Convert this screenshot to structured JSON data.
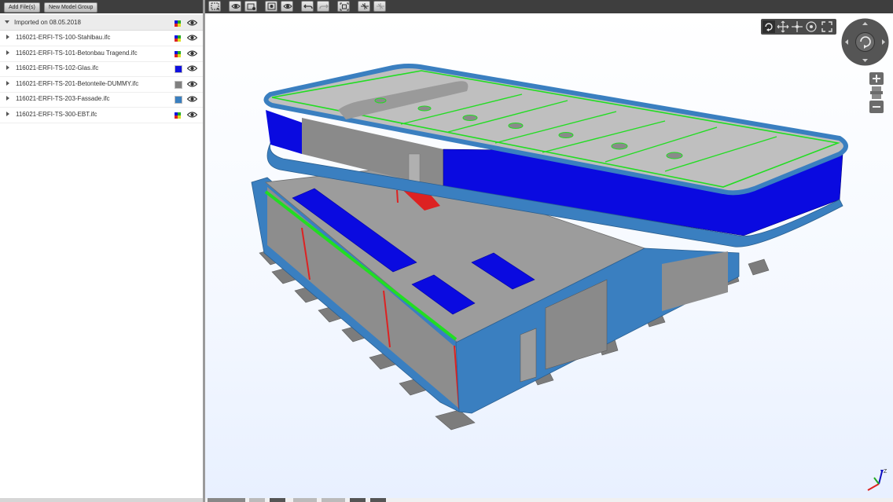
{
  "toolbar": {
    "add_files": "Add File(s)",
    "new_model_group": "New Model Group"
  },
  "model_group": {
    "label": "Imported on 08.05.2018"
  },
  "files": [
    {
      "label": "116021-ERFI-TS-100-Stahlbau.ifc",
      "swatch": "multi"
    },
    {
      "label": "116021-ERFI-TS-101-Betonbau Tragend.ifc",
      "swatch": "multi"
    },
    {
      "label": "116021-ERFI-TS-102-Glas.ifc",
      "swatch": "#1010e0"
    },
    {
      "label": "116021-ERFI-TS-201-Betonteile-DUMMY.ifc",
      "swatch": "#808080"
    },
    {
      "label": "116021-ERFI-TS-203-Fassade.ifc",
      "swatch": "#3a7fc0"
    },
    {
      "label": "116021-ERFI-TS-300-EBT.ifc",
      "swatch": "multi"
    }
  ],
  "colors": {
    "concrete": "#8f8f8f",
    "concrete_light": "#b3b3b3",
    "facade": "#3778b8",
    "glass": "#0a0ae0",
    "accent_green": "#22dd22",
    "accent_red": "#dd2222",
    "dark_bar": "#3e3e3e"
  },
  "viewer_icons": [
    "box-select-icon",
    "eye-show-icon",
    "eye-hide-icon",
    "isolate-icon",
    "show-all-icon",
    "undo-icon",
    "redo-icon",
    "fit-view-icon",
    "cut-plane-icon",
    "cut-plane-off-icon"
  ],
  "nav_icons": [
    "orbit-icon",
    "pan-icon",
    "walk-icon",
    "look-icon",
    "fullscreen-icon"
  ]
}
